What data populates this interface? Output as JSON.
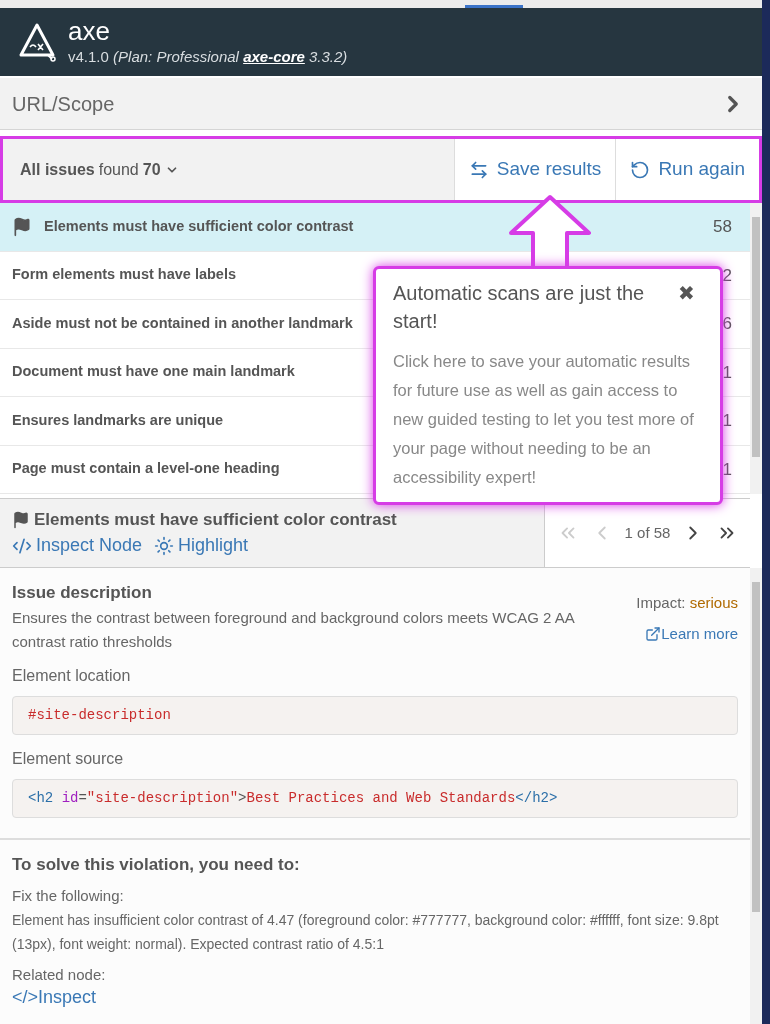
{
  "header": {
    "title": "axe",
    "version": "v4.1.0",
    "plan": "(Plan: Professional ",
    "core_link": "axe-core",
    "core_version": " 3.3.2)"
  },
  "scope": {
    "label": "URL/Scope"
  },
  "issues_bar": {
    "label": "All issues",
    "found": "found",
    "count": "70",
    "buttons": [
      {
        "kind": "save",
        "label": "Save results"
      },
      {
        "kind": "run",
        "label": "Run again"
      }
    ]
  },
  "issues": [
    {
      "title": "Elements must have sufficient color contrast",
      "count": "58",
      "selected": true
    },
    {
      "title": "Form elements must have labels",
      "count": "2",
      "selected": false
    },
    {
      "title": "Aside must not be contained in another landmark",
      "count": "6",
      "selected": false
    },
    {
      "title": "Document must have one main landmark",
      "count": "1",
      "selected": false
    },
    {
      "title": "Ensures landmarks are unique",
      "count": "1",
      "selected": false
    },
    {
      "title": "Page must contain a level-one heading",
      "count": "1",
      "selected": false
    }
  ],
  "popover": {
    "title": "Automatic scans are just the start!",
    "close": "✖",
    "body": "Click here to save your automatic results for future use as well as gain access to new guided testing to let you test more of your page without needing to be an accessibility expert!"
  },
  "detail": {
    "title": "Elements must have sufficient color contrast",
    "inspect": "Inspect Node",
    "highlight": "Highlight",
    "pager": "1 of 58"
  },
  "description": {
    "heading": "Issue description",
    "text": "Ensures the contrast between foreground and background colors meets WCAG 2 AA contrast ratio thresholds",
    "impact_label": "Impact:",
    "impact": "serious",
    "learn_more": "Learn more",
    "location_label": "Element location",
    "location": "#site-description",
    "source_label": "Element source",
    "source": {
      "open_tag": "<h2",
      "attr": "id",
      "eq": "=",
      "value": "\"site-description\"",
      "close": ">",
      "text": "Best Practices and Web Standards",
      "end_tag": "</h2>"
    }
  },
  "solve": {
    "heading": "To solve this violation, you need to:",
    "fix_label": "Fix the following:",
    "fix_text": "Element has insufficient color contrast of 4.47 (foreground color: #777777, background color: #ffffff, font size: 9.8pt (13px), font weight: normal). Expected contrast ratio of 4.5:1",
    "related_label": "Related node:",
    "inspect": "</>Inspect"
  }
}
